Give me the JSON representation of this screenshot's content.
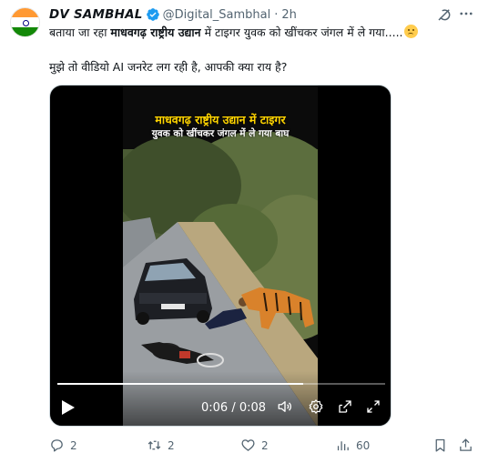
{
  "post": {
    "author": {
      "display_name": "DV SAMBHAL",
      "handle": "@Digital_Sambhal",
      "separator": "·",
      "time": "2h",
      "avatar": "india-flag-avatar",
      "verified": true
    },
    "text_line1_a": "बताया जा रहा ",
    "text_line1_bold": "माधवगढ़ राष्ट्रीय उद्यान",
    "text_line1_b": " में टाइगर युवक को खींचकर जंगल में ले गया.....",
    "text_line1_emoji": "thinking-face",
    "text_line2": "मुझे तो वीडियो AI जनरेट लग रही है, आपकी क्या राय है?"
  },
  "media": {
    "caption_line1": "माधवगढ़ राष्ट्रीय उद्यान में टाइगर",
    "caption_line2": "युवक को खींचकर जंगल में ले गया बाघ",
    "player": {
      "time_display": "0:06 / 0:08",
      "progress_fraction": 0.75
    }
  },
  "actions": {
    "replies": "2",
    "reposts": "2",
    "likes": "2",
    "views": "60"
  },
  "colors": {
    "text": "#0f1419",
    "muted": "#536471",
    "verified": "#1d9bf0",
    "caption_yellow": "#ffd400"
  }
}
